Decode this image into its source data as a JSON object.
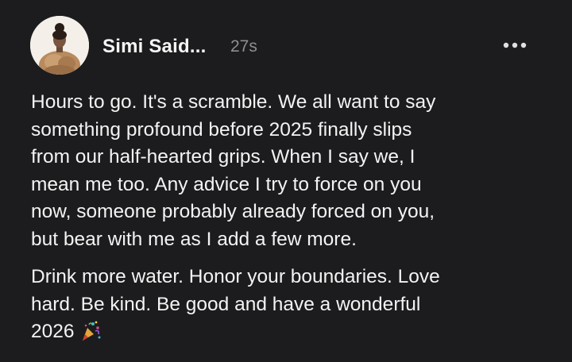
{
  "post": {
    "author": "Simi Said...",
    "time": "27s",
    "more_icon": "more-horizontal-icon",
    "paragraphs": [
      "Hours to go. It's a scramble. We all want to say\nsomething profound before 2025 finally slips\nfrom our half-hearted grips. When I say we, I\nmean me too. Any advice I try to force on you\nnow, someone probably already forced on you,\nbut bear with me as I add a few more.",
      "Drink more water. Honor your boundaries. Love\nhard. Be kind. Be good and have a wonderful\n2026"
    ],
    "end_emoji_icon": "party-popper-icon"
  },
  "colors": {
    "background": "#1c1c1e",
    "text": "#f3f3f3",
    "muted": "#8e8e93"
  }
}
